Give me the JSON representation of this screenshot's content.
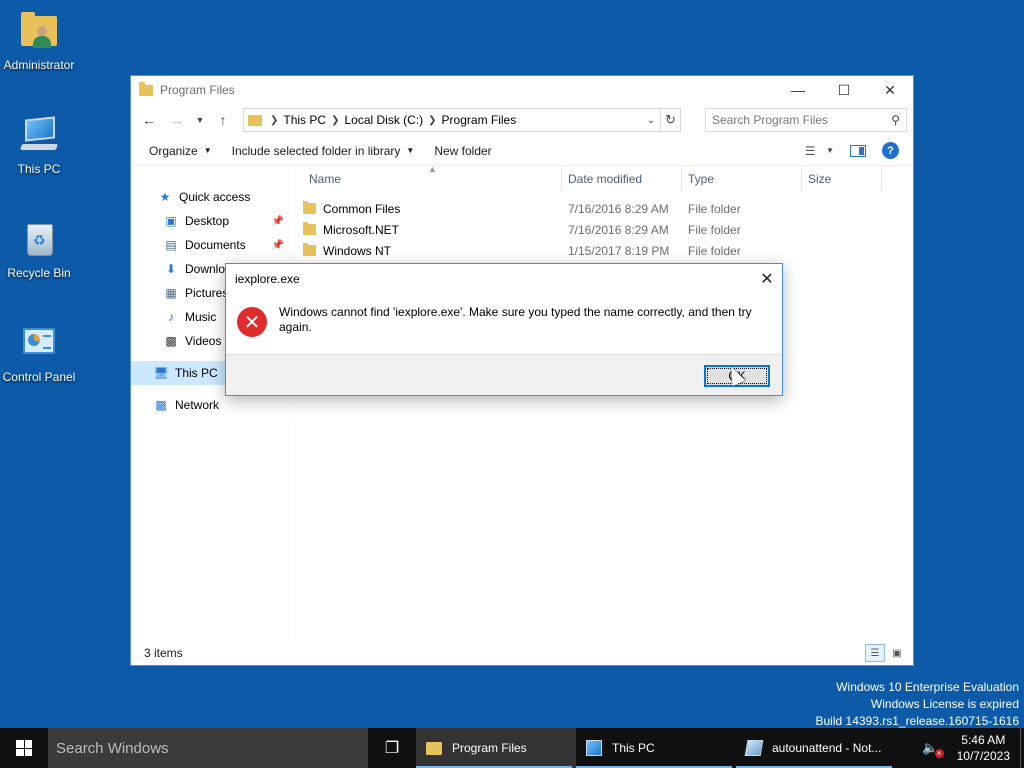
{
  "desktop": {
    "icons": [
      {
        "label": "Administrator",
        "icon": "user-folder-icon"
      },
      {
        "label": "This PC",
        "icon": "computer-icon"
      },
      {
        "label": "Recycle Bin",
        "icon": "recycle-bin-icon"
      },
      {
        "label": "Control Panel",
        "icon": "control-panel-icon"
      }
    ]
  },
  "explorer": {
    "title": "Program Files",
    "breadcrumbs": [
      "This PC",
      "Local Disk (C:)",
      "Program Files"
    ],
    "search_placeholder": "Search Program Files",
    "commands": {
      "organize": "Organize",
      "include": "Include selected folder in library",
      "new_folder": "New folder"
    },
    "nav": {
      "quick_access": "Quick access",
      "desktop": "Desktop",
      "documents": "Documents",
      "downloads": "Downlo",
      "pictures": "Pictures",
      "music": "Music",
      "videos": "Videos",
      "this_pc": "This PC",
      "network": "Network"
    },
    "columns": {
      "name": "Name",
      "date": "Date modified",
      "type": "Type",
      "size": "Size"
    },
    "files": [
      {
        "name": "Common Files",
        "date": "7/16/2016 8:29 AM",
        "type": "File folder"
      },
      {
        "name": "Microsoft.NET",
        "date": "7/16/2016 8:29 AM",
        "type": "File folder"
      },
      {
        "name": "Windows NT",
        "date": "1/15/2017 8:19 PM",
        "type": "File folder"
      }
    ],
    "status": "3 items"
  },
  "dialog": {
    "title": "iexplore.exe",
    "message": "Windows cannot find 'iexplore.exe'. Make sure you typed the name correctly, and then try again.",
    "ok_label": "OK"
  },
  "watermark": {
    "line1": "Windows 10 Enterprise Evaluation",
    "line2": "Windows License is expired",
    "line3": "Build 14393.rs1_release.160715-1616"
  },
  "taskbar": {
    "search_placeholder": "Search Windows",
    "apps": [
      {
        "label": "Program Files",
        "icon": "folder-icon"
      },
      {
        "label": "This PC",
        "icon": "computer-icon"
      },
      {
        "label": "autounattend - Not...",
        "icon": "notepad-icon"
      }
    ],
    "time": "5:46 AM",
    "date": "10/7/2023"
  }
}
